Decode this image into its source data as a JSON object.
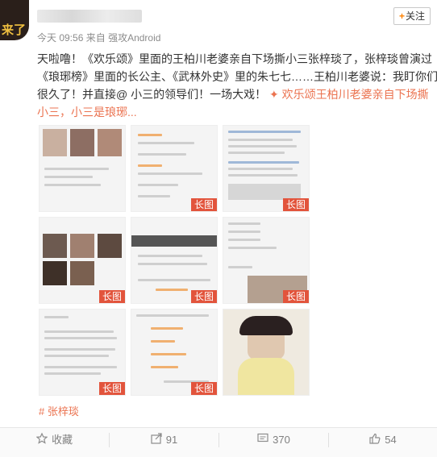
{
  "header": {
    "avatar_text": "来了",
    "meta_time": "今天 09:56",
    "meta_from": "来自",
    "meta_source": "强攻Android",
    "follow_label": "关注",
    "follow_plus": "+"
  },
  "post": {
    "lines": [
      "天啦噜！《欢乐颂》里面的王柏川老婆亲自下场撕小三张梓琰了，张梓琰曾演过",
      "《琅琊榜》里面的长公主、《武林外史》里的朱七七……王柏川老婆说：我盯你们",
      "很久了！并直接@ 小三的领导们！一场大戏！"
    ],
    "topic_link": "欢乐颂王柏川老婆亲自下场撕",
    "topic_link_cont": "小三，小三是琅琊...",
    "topic_icon": "🔗"
  },
  "images": [
    {
      "badge": ""
    },
    {
      "badge": "长图"
    },
    {
      "badge": "长图"
    },
    {
      "badge": "长图"
    },
    {
      "badge": "长图"
    },
    {
      "badge": "长图"
    },
    {
      "badge": "长图"
    },
    {
      "badge": "长图"
    },
    {
      "badge": ""
    }
  ],
  "topic_tag": "# 张梓琰",
  "actions": {
    "collect": "收藏",
    "share": "91",
    "comment": "370",
    "like": "54"
  },
  "colors": {
    "accent": "#eb7350",
    "badge": "#e2543c",
    "follow_plus": "#ff8200"
  }
}
